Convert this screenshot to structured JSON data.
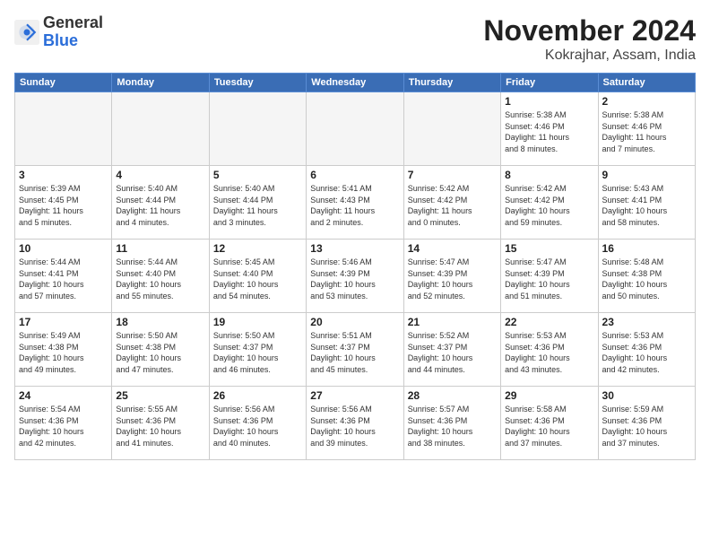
{
  "header": {
    "logo_general": "General",
    "logo_blue": "Blue",
    "month_title": "November 2024",
    "location": "Kokrajhar, Assam, India"
  },
  "weekdays": [
    "Sunday",
    "Monday",
    "Tuesday",
    "Wednesday",
    "Thursday",
    "Friday",
    "Saturday"
  ],
  "weeks": [
    [
      {
        "day": "",
        "detail": ""
      },
      {
        "day": "",
        "detail": ""
      },
      {
        "day": "",
        "detail": ""
      },
      {
        "day": "",
        "detail": ""
      },
      {
        "day": "",
        "detail": ""
      },
      {
        "day": "1",
        "detail": "Sunrise: 5:38 AM\nSunset: 4:46 PM\nDaylight: 11 hours\nand 8 minutes."
      },
      {
        "day": "2",
        "detail": "Sunrise: 5:38 AM\nSunset: 4:46 PM\nDaylight: 11 hours\nand 7 minutes."
      }
    ],
    [
      {
        "day": "3",
        "detail": "Sunrise: 5:39 AM\nSunset: 4:45 PM\nDaylight: 11 hours\nand 5 minutes."
      },
      {
        "day": "4",
        "detail": "Sunrise: 5:40 AM\nSunset: 4:44 PM\nDaylight: 11 hours\nand 4 minutes."
      },
      {
        "day": "5",
        "detail": "Sunrise: 5:40 AM\nSunset: 4:44 PM\nDaylight: 11 hours\nand 3 minutes."
      },
      {
        "day": "6",
        "detail": "Sunrise: 5:41 AM\nSunset: 4:43 PM\nDaylight: 11 hours\nand 2 minutes."
      },
      {
        "day": "7",
        "detail": "Sunrise: 5:42 AM\nSunset: 4:42 PM\nDaylight: 11 hours\nand 0 minutes."
      },
      {
        "day": "8",
        "detail": "Sunrise: 5:42 AM\nSunset: 4:42 PM\nDaylight: 10 hours\nand 59 minutes."
      },
      {
        "day": "9",
        "detail": "Sunrise: 5:43 AM\nSunset: 4:41 PM\nDaylight: 10 hours\nand 58 minutes."
      }
    ],
    [
      {
        "day": "10",
        "detail": "Sunrise: 5:44 AM\nSunset: 4:41 PM\nDaylight: 10 hours\nand 57 minutes."
      },
      {
        "day": "11",
        "detail": "Sunrise: 5:44 AM\nSunset: 4:40 PM\nDaylight: 10 hours\nand 55 minutes."
      },
      {
        "day": "12",
        "detail": "Sunrise: 5:45 AM\nSunset: 4:40 PM\nDaylight: 10 hours\nand 54 minutes."
      },
      {
        "day": "13",
        "detail": "Sunrise: 5:46 AM\nSunset: 4:39 PM\nDaylight: 10 hours\nand 53 minutes."
      },
      {
        "day": "14",
        "detail": "Sunrise: 5:47 AM\nSunset: 4:39 PM\nDaylight: 10 hours\nand 52 minutes."
      },
      {
        "day": "15",
        "detail": "Sunrise: 5:47 AM\nSunset: 4:39 PM\nDaylight: 10 hours\nand 51 minutes."
      },
      {
        "day": "16",
        "detail": "Sunrise: 5:48 AM\nSunset: 4:38 PM\nDaylight: 10 hours\nand 50 minutes."
      }
    ],
    [
      {
        "day": "17",
        "detail": "Sunrise: 5:49 AM\nSunset: 4:38 PM\nDaylight: 10 hours\nand 49 minutes."
      },
      {
        "day": "18",
        "detail": "Sunrise: 5:50 AM\nSunset: 4:38 PM\nDaylight: 10 hours\nand 47 minutes."
      },
      {
        "day": "19",
        "detail": "Sunrise: 5:50 AM\nSunset: 4:37 PM\nDaylight: 10 hours\nand 46 minutes."
      },
      {
        "day": "20",
        "detail": "Sunrise: 5:51 AM\nSunset: 4:37 PM\nDaylight: 10 hours\nand 45 minutes."
      },
      {
        "day": "21",
        "detail": "Sunrise: 5:52 AM\nSunset: 4:37 PM\nDaylight: 10 hours\nand 44 minutes."
      },
      {
        "day": "22",
        "detail": "Sunrise: 5:53 AM\nSunset: 4:36 PM\nDaylight: 10 hours\nand 43 minutes."
      },
      {
        "day": "23",
        "detail": "Sunrise: 5:53 AM\nSunset: 4:36 PM\nDaylight: 10 hours\nand 42 minutes."
      }
    ],
    [
      {
        "day": "24",
        "detail": "Sunrise: 5:54 AM\nSunset: 4:36 PM\nDaylight: 10 hours\nand 42 minutes."
      },
      {
        "day": "25",
        "detail": "Sunrise: 5:55 AM\nSunset: 4:36 PM\nDaylight: 10 hours\nand 41 minutes."
      },
      {
        "day": "26",
        "detail": "Sunrise: 5:56 AM\nSunset: 4:36 PM\nDaylight: 10 hours\nand 40 minutes."
      },
      {
        "day": "27",
        "detail": "Sunrise: 5:56 AM\nSunset: 4:36 PM\nDaylight: 10 hours\nand 39 minutes."
      },
      {
        "day": "28",
        "detail": "Sunrise: 5:57 AM\nSunset: 4:36 PM\nDaylight: 10 hours\nand 38 minutes."
      },
      {
        "day": "29",
        "detail": "Sunrise: 5:58 AM\nSunset: 4:36 PM\nDaylight: 10 hours\nand 37 minutes."
      },
      {
        "day": "30",
        "detail": "Sunrise: 5:59 AM\nSunset: 4:36 PM\nDaylight: 10 hours\nand 37 minutes."
      }
    ]
  ]
}
